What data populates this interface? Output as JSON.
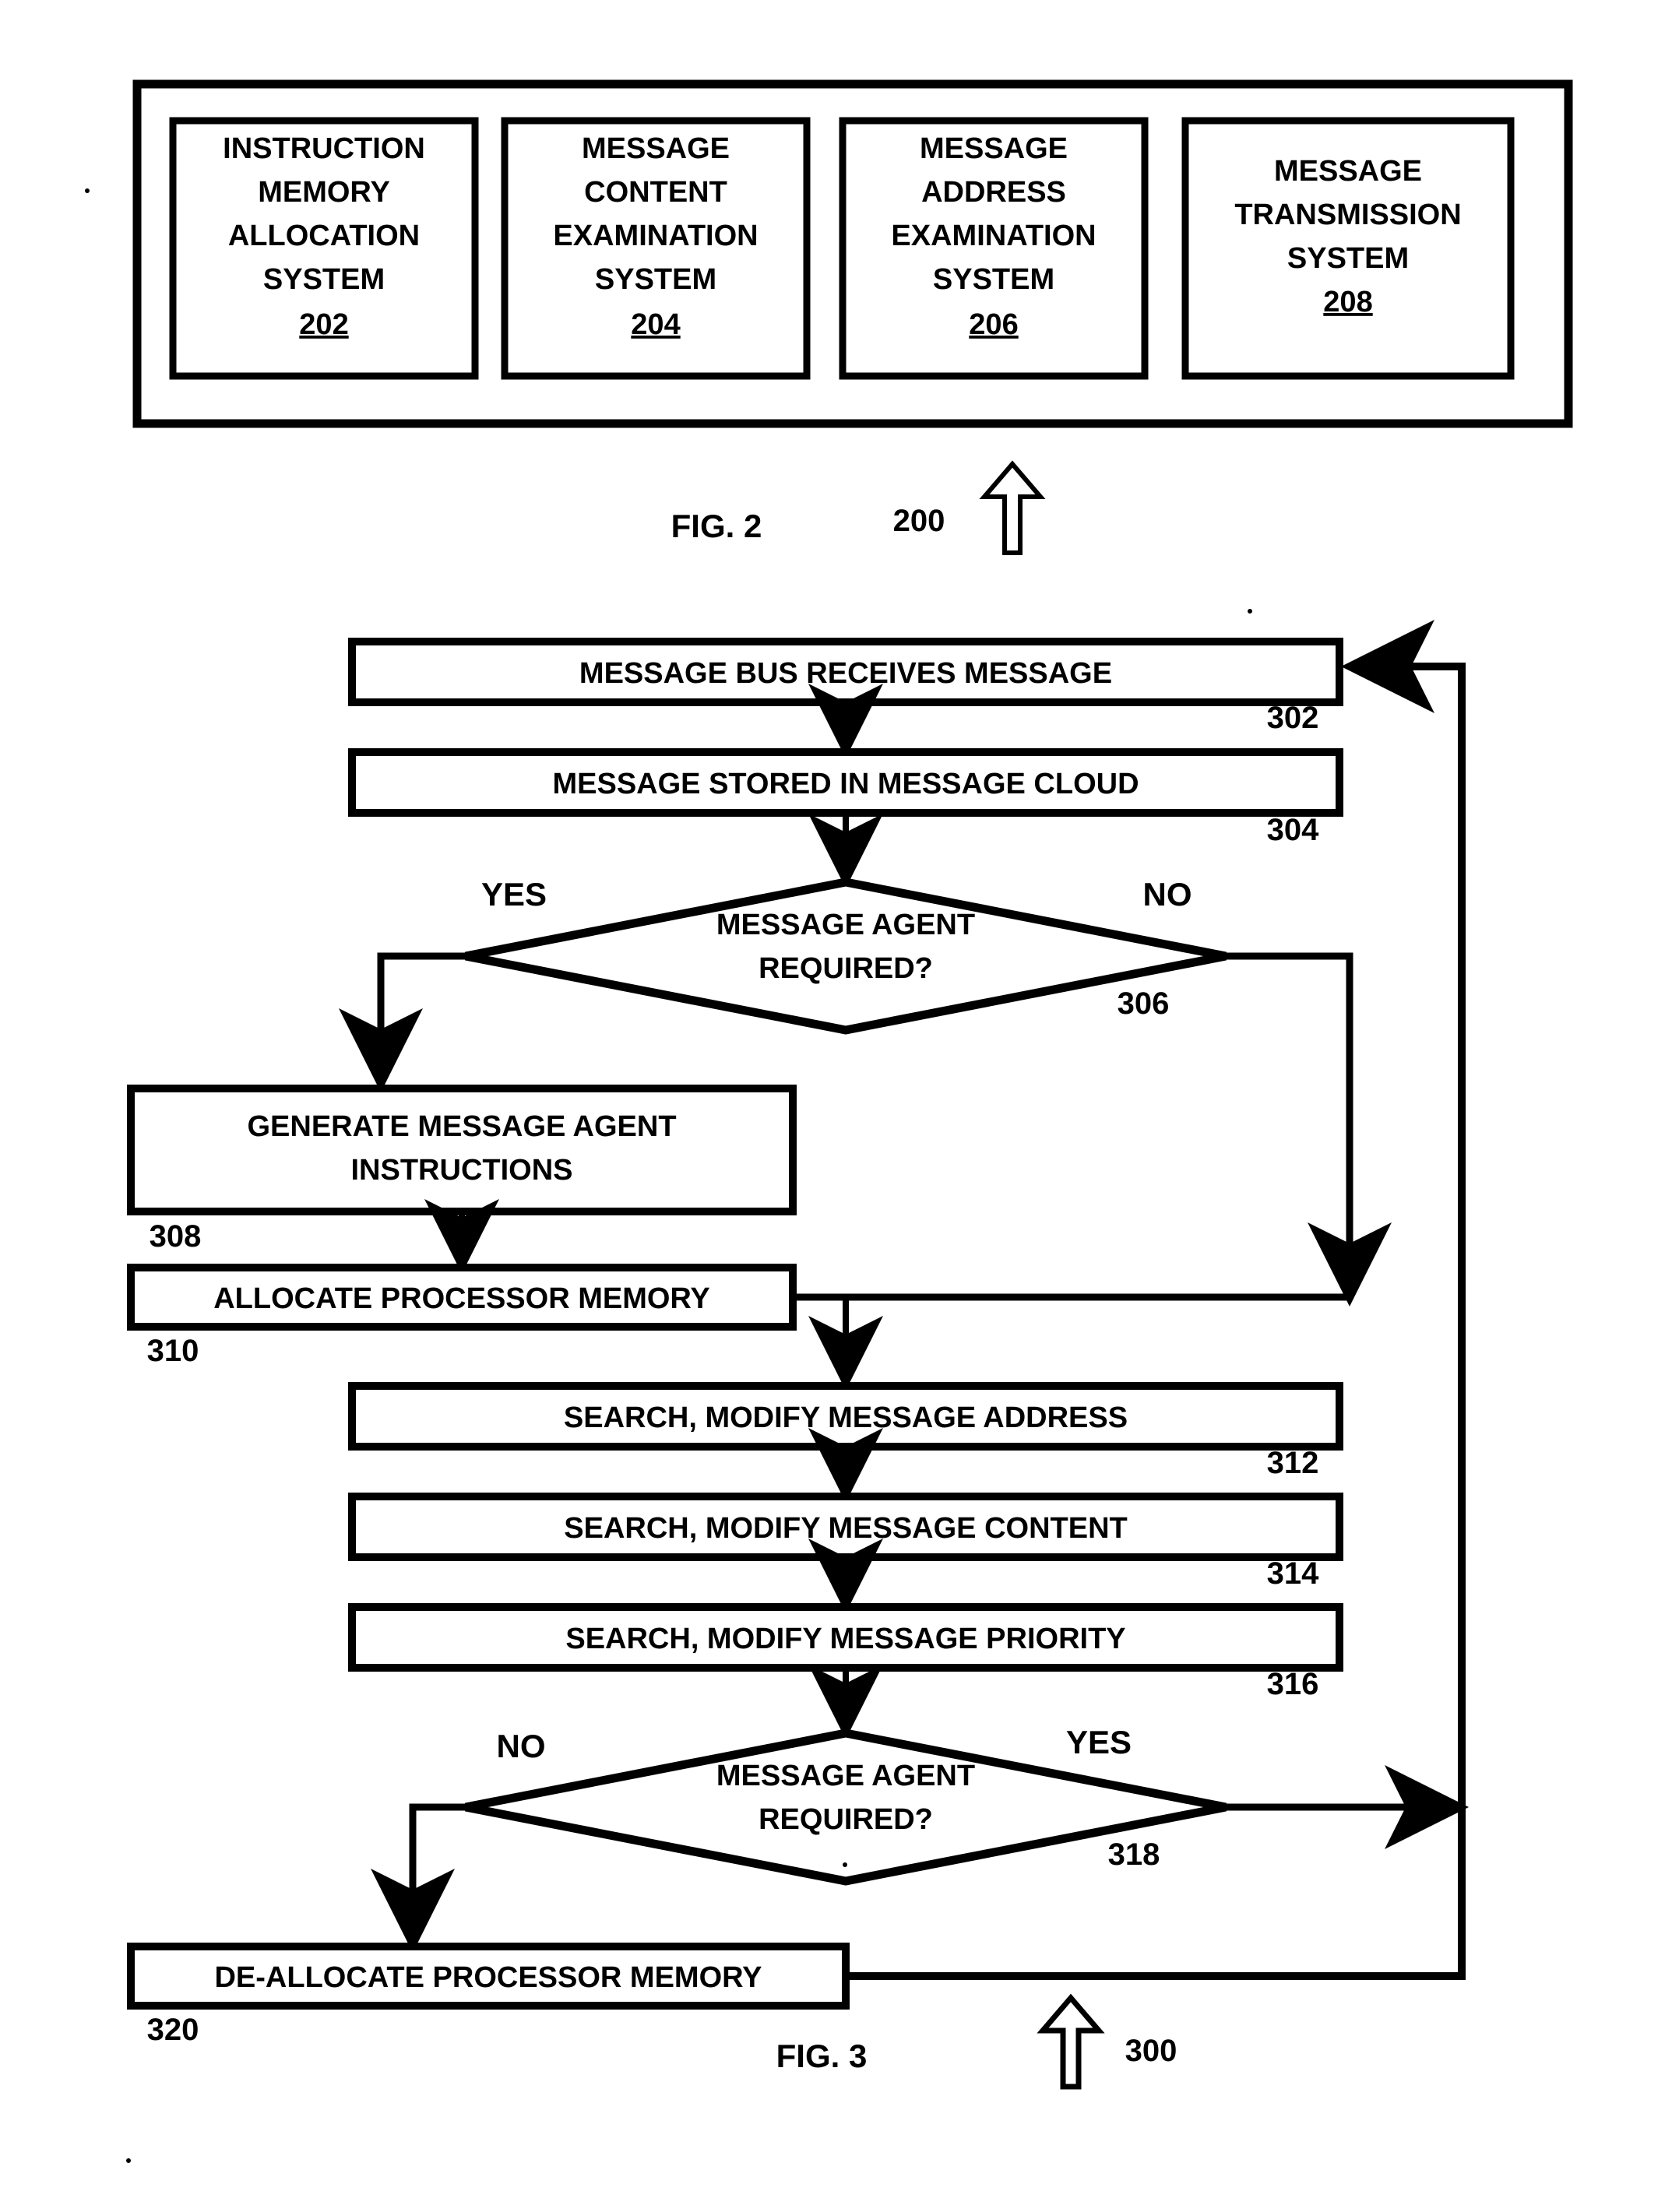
{
  "document": {
    "type": "patent-drawing-sheet",
    "figures": [
      "FIG. 2",
      "FIG. 3"
    ]
  },
  "fig2": {
    "caption": "FIG. 2",
    "ref": "200",
    "arrow_icon": "up-arrow-icon",
    "modules": [
      {
        "lines": [
          "INSTRUCTION",
          "MEMORY",
          "ALLOCATION",
          "SYSTEM"
        ],
        "ref": "202"
      },
      {
        "lines": [
          "MESSAGE",
          "CONTENT",
          "EXAMINATION",
          "SYSTEM"
        ],
        "ref": "204"
      },
      {
        "lines": [
          "MESSAGE",
          "ADDRESS",
          "EXAMINATION",
          "SYSTEM"
        ],
        "ref": "206"
      },
      {
        "lines": [
          "MESSAGE",
          "TRANSMISSION",
          "SYSTEM"
        ],
        "ref": "208"
      }
    ]
  },
  "fig3": {
    "caption": "FIG. 3",
    "ref": "300",
    "arrow_icon": "up-arrow-icon",
    "steps": [
      {
        "id": "s302",
        "label": "MESSAGE BUS RECEIVES MESSAGE",
        "ref": "302",
        "shape": "process"
      },
      {
        "id": "s304",
        "label": "MESSAGE STORED IN MESSAGE CLOUD",
        "ref": "304",
        "shape": "process"
      },
      {
        "id": "s306",
        "label_line1": "MESSAGE AGENT",
        "label_line2": "REQUIRED?",
        "ref": "306",
        "shape": "decision",
        "left_branch": "YES",
        "right_branch": "NO"
      },
      {
        "id": "s308",
        "label_line1": "GENERATE MESSAGE AGENT",
        "label_line2": "INSTRUCTIONS",
        "ref": "308",
        "shape": "process"
      },
      {
        "id": "s310",
        "label": "ALLOCATE PROCESSOR MEMORY",
        "ref": "310",
        "shape": "process"
      },
      {
        "id": "s312",
        "label": "SEARCH, MODIFY MESSAGE ADDRESS",
        "ref": "312",
        "shape": "process"
      },
      {
        "id": "s314",
        "label": "SEARCH, MODIFY MESSAGE CONTENT",
        "ref": "314",
        "shape": "process"
      },
      {
        "id": "s316",
        "label": "SEARCH, MODIFY MESSAGE PRIORITY",
        "ref": "316",
        "shape": "process"
      },
      {
        "id": "s318",
        "label_line1": "MESSAGE AGENT",
        "label_line2": "REQUIRED?",
        "ref": "318",
        "shape": "decision",
        "left_branch": "NO",
        "right_branch": "YES"
      },
      {
        "id": "s320",
        "label": "DE-ALLOCATE PROCESSOR MEMORY",
        "ref": "320",
        "shape": "process"
      }
    ]
  },
  "colors": {
    "ink": "#000000",
    "paper": "#ffffff"
  }
}
